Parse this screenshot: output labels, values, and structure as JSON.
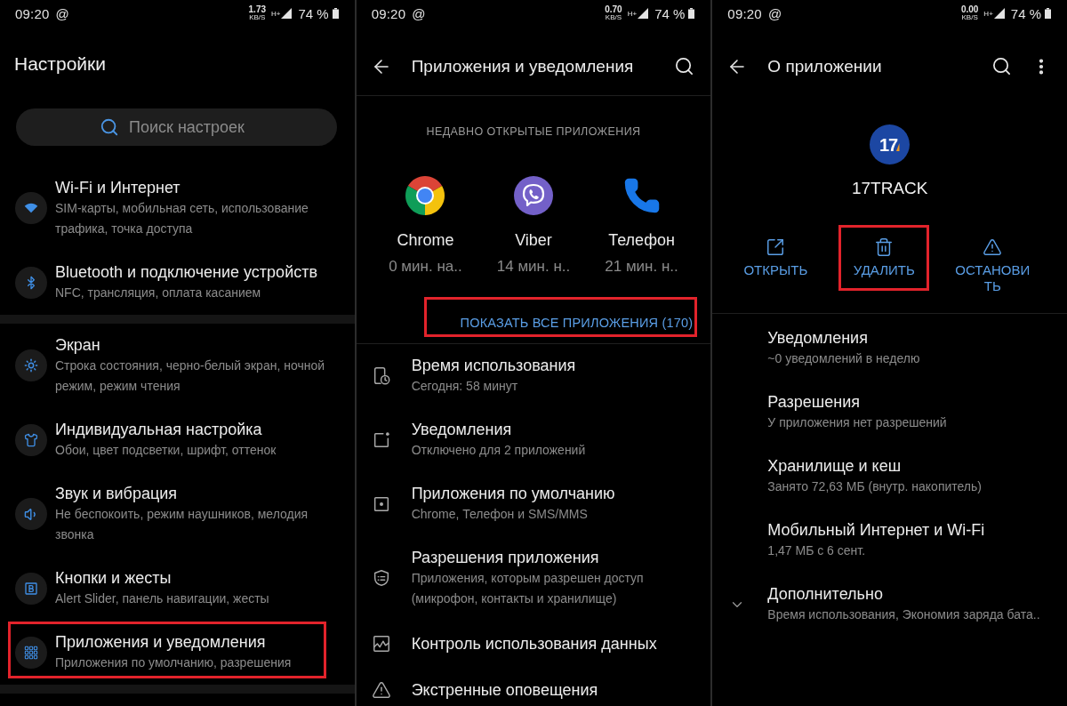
{
  "settings_screen": {
    "status_bar": {
      "time": "09:20",
      "notification_glyph": "@",
      "speed": "1.73",
      "speed_unit": "KB/S",
      "network_type": "H+",
      "battery": "74 %"
    },
    "title": "Настройки",
    "search": {
      "placeholder": "Поиск настроек"
    },
    "sections": [
      {
        "items": [
          {
            "title": "Wi-Fi и Интернет",
            "subtitle": "SIM-карты, мобильная сеть, использование трафика, точка доступа",
            "highlighted": false
          },
          {
            "title": "Bluetooth и подключение устройств",
            "subtitle": "NFC, трансляция, оплата касанием",
            "highlighted": false
          }
        ]
      },
      {
        "items": [
          {
            "title": "Экран",
            "subtitle": "Строка состояния, черно-белый экран, ночной режим, режим чтения",
            "highlighted": false
          },
          {
            "title": "Индивидуальная настройка",
            "subtitle": "Обои, цвет подсветки, шрифт, оттенок",
            "highlighted": false
          },
          {
            "title": "Звук и вибрация",
            "subtitle": "Не беспокоить, режим наушников, мелодия звонка",
            "highlighted": false
          },
          {
            "title": "Кнопки и жесты",
            "subtitle": "Alert Slider, панель навигации, жесты",
            "highlighted": false
          },
          {
            "title": "Приложения и уведомления",
            "subtitle": "Приложения по умолчанию, разрешения",
            "highlighted": true
          }
        ]
      }
    ]
  },
  "apps_screen": {
    "status_bar": {
      "time": "09:20",
      "notification_glyph": "@",
      "speed": "0.70",
      "speed_unit": "KB/S",
      "network_type": "H+",
      "battery": "74 %"
    },
    "title": "Приложения и уведомления",
    "recent": {
      "heading": "НЕДАВНО ОТКРЫТЫЕ ПРИЛОЖЕНИЯ",
      "apps": [
        {
          "kind": "chrome",
          "name": "Chrome",
          "usage": "0 мин. на.."
        },
        {
          "kind": "viber",
          "name": "Viber",
          "usage": "14 мин. н.."
        },
        {
          "kind": "phone",
          "name": "Телефон",
          "usage": "21 мин. н.."
        }
      ]
    },
    "show_all": {
      "label": "ПОКАЗАТЬ ВСЕ ПРИЛОЖЕНИЯ (170)",
      "highlighted": true
    },
    "items": [
      {
        "title": "Время использования",
        "subtitle": "Сегодня: 58 минут"
      },
      {
        "title": "Уведомления",
        "subtitle": "Отключено для 2 приложений"
      },
      {
        "title": "Приложения по умолчанию",
        "subtitle": "Chrome, Телефон и SMS/MMS"
      },
      {
        "title": "Разрешения приложения",
        "subtitle": "Приложения, которым разрешен доступ (микрофон, контакты и хранилище)"
      },
      {
        "title": "Контроль использования данных"
      },
      {
        "title": "Экстренные оповещения"
      }
    ]
  },
  "app_info_screen": {
    "status_bar": {
      "time": "09:20",
      "notification_glyph": "@",
      "speed": "0.00",
      "speed_unit": "KB/S",
      "network_type": "H+",
      "battery": "74 %"
    },
    "title": "О приложении",
    "app": {
      "logo_text": "17",
      "name": "17TRACK"
    },
    "actions": [
      {
        "label": "ОТКРЫТЬ",
        "highlighted": false
      },
      {
        "label": "УДАЛИТЬ",
        "highlighted": true
      },
      {
        "label": "ОСТАНОВИТЬ",
        "highlighted": false
      }
    ],
    "items": [
      {
        "kind": "entry",
        "title": "Уведомления",
        "subtitle": "~0 уведомлений в неделю"
      },
      {
        "kind": "entry",
        "title": "Разрешения",
        "subtitle": "У приложения нет разрешений"
      },
      {
        "kind": "entry",
        "title": "Хранилище и кеш",
        "subtitle": "Занято 72,63 МБ (внутр. накопитель)"
      },
      {
        "kind": "entry",
        "title": "Мобильный Интернет и Wi-Fi",
        "subtitle": "1,47 МБ с 6 сент."
      },
      {
        "kind": "expander",
        "title": "Дополнительно",
        "subtitle": "Время использования, Экономия заряда бата.."
      }
    ]
  }
}
